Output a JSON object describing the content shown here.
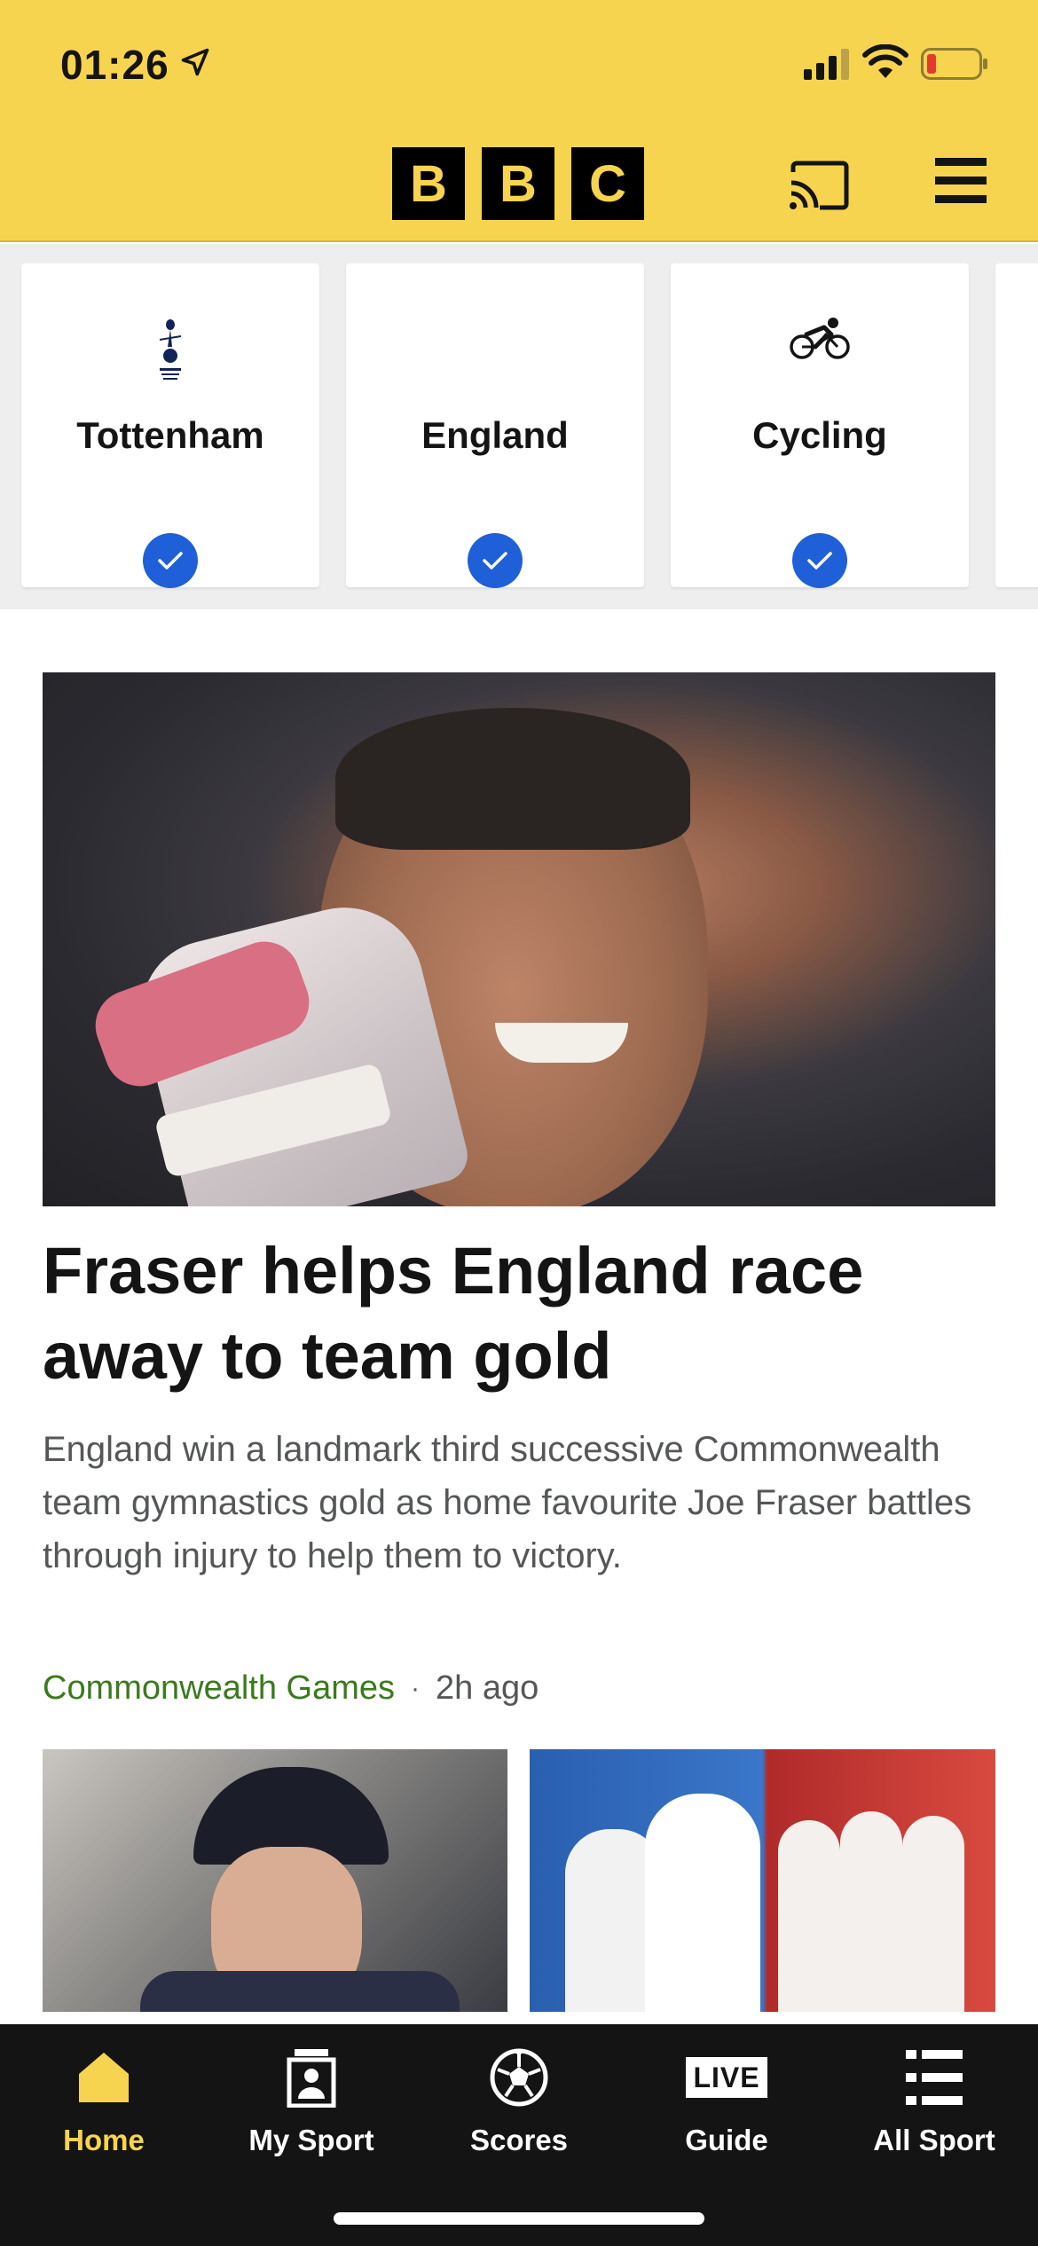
{
  "status_bar": {
    "time": "01:26"
  },
  "header": {
    "logo_letters": [
      "B",
      "B",
      "C"
    ],
    "brand_color": "#f6d44f",
    "icons": [
      "cast-icon",
      "menu-icon"
    ]
  },
  "topics": [
    {
      "label": "Tottenham",
      "icon": "tottenham-crest-icon",
      "followed": true
    },
    {
      "label": "England",
      "icon": "none",
      "followed": true
    },
    {
      "label": "Cycling",
      "icon": "cycling-icon",
      "followed": true
    }
  ],
  "main_story": {
    "headline": "Fraser helps England race away to team gold",
    "summary": "England win a landmark third successive Commonwealth team gymnastics gold as home favourite Joe Fraser battles through injury to help them to victory.",
    "topic": "Commonwealth Games",
    "separator": "·",
    "time_ago": "2h ago"
  },
  "tabbar": {
    "tabs": [
      {
        "label": "Home",
        "icon": "home-icon",
        "active": true
      },
      {
        "label": "My Sport",
        "icon": "my-sport-icon",
        "active": false
      },
      {
        "label": "Scores",
        "icon": "football-icon",
        "active": false
      },
      {
        "label": "Guide",
        "icon": "live-guide-icon",
        "icon_text": "LIVE",
        "active": false
      },
      {
        "label": "All Sport",
        "icon": "list-icon",
        "active": false
      }
    ]
  },
  "colors": {
    "accent": "#f6d44f",
    "check": "#1f5fd8",
    "topic_link": "#3a7a1c",
    "tabbar": "#141414"
  }
}
